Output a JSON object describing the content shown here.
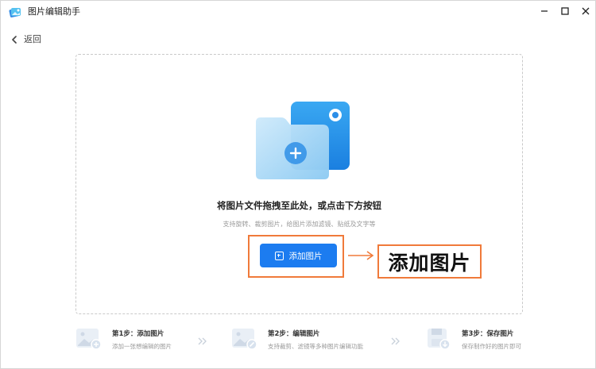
{
  "app": {
    "title": "图片编辑助手",
    "logo_icon": "app-logo-icon"
  },
  "window_controls": {
    "minimize_icon": "minimize-icon",
    "maximize_icon": "maximize-icon",
    "close_icon": "close-icon"
  },
  "nav": {
    "back_label": "返回",
    "back_icon": "chevron-left-icon"
  },
  "dropzone": {
    "heading": "将图片文件拖拽至此处，或点击下方按钮",
    "subtext": "支持旋转、裁剪图片，给图片添加滤镜、贴纸及文字等",
    "illustration_icon": "folder-add-image-icon",
    "add_button_label": "添加图片",
    "add_button_icon": "plus-square-icon"
  },
  "annotation": {
    "callout_text": "添加图片",
    "accent_color": "#f07a3a"
  },
  "steps": [
    {
      "title": "第1步：添加图片",
      "desc": "添加一张想编辑的图片",
      "icon": "image-add-icon"
    },
    {
      "title": "第2步：编辑图片",
      "desc": "支持裁剪、滤镜等多种图片编辑功能",
      "icon": "image-edit-icon"
    },
    {
      "title": "第3步：保存图片",
      "desc": "保存制作好的图片即可",
      "icon": "save-download-icon"
    }
  ],
  "colors": {
    "primary": "#1c7cf0",
    "highlight": "#f07a3a",
    "muted_text": "#9a9a9a"
  }
}
